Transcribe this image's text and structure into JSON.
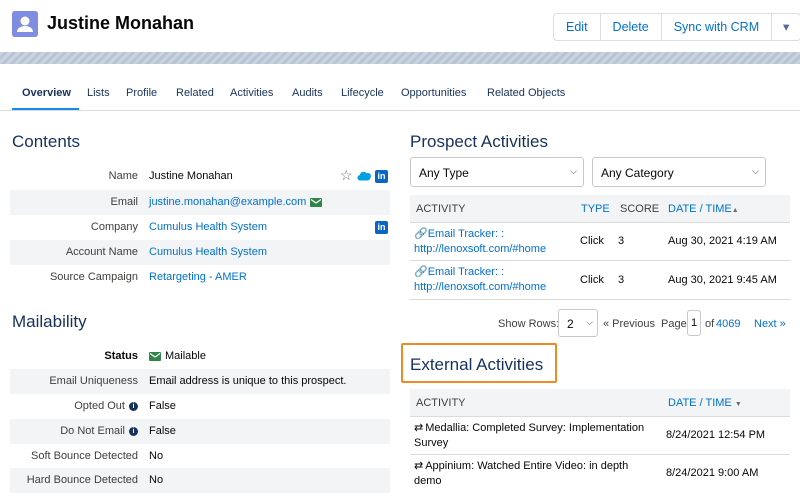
{
  "record": {
    "name": "Justine Monahan"
  },
  "actions": {
    "edit": "Edit",
    "delete": "Delete",
    "sync": "Sync with CRM",
    "more": "▾"
  },
  "tabs": [
    "Overview",
    "Lists",
    "Profile",
    "Related",
    "Activities",
    "Audits",
    "Lifecycle",
    "Opportunities",
    "Related Objects"
  ],
  "contents": {
    "title": "Contents",
    "rows": [
      {
        "label": "Name",
        "value": "Justine Monahan"
      },
      {
        "label": "Email",
        "value": "justine.monahan@example.com"
      },
      {
        "label": "Company",
        "value": "Cumulus Health System"
      },
      {
        "label": "Account Name",
        "value": "Cumulus Health System"
      },
      {
        "label": "Source Campaign",
        "value": "Retargeting - AMER"
      }
    ]
  },
  "mailability": {
    "title": "Mailability",
    "rows": [
      {
        "label": "Status",
        "value": "Mailable"
      },
      {
        "label": "Email Uniqueness",
        "value": "Email address is unique to this prospect."
      },
      {
        "label": "Opted Out",
        "value": "False"
      },
      {
        "label": "Do Not Email",
        "value": "False"
      },
      {
        "label": "Soft Bounce Detected",
        "value": "No"
      },
      {
        "label": "Hard Bounce Detected",
        "value": "No"
      }
    ]
  },
  "prospect_activities": {
    "title": "Prospect Activities",
    "type_filter": "Any Type",
    "category_filter": "Any Category",
    "headers": {
      "activity": "ACTIVITY",
      "type": "TYPE",
      "score": "SCORE",
      "date": "DATE / TIME"
    },
    "rows": [
      {
        "activity_line1": "Email Tracker: :",
        "activity_line2": "http://lenoxsoft.com/#home",
        "type": "Click",
        "score": "3",
        "date": "Aug 30, 2021 4:19 AM"
      },
      {
        "activity_line1": "Email Tracker: :",
        "activity_line2": "http://lenoxsoft.com/#home",
        "type": "Click",
        "score": "3",
        "date": "Aug 30, 2021 9:45 AM"
      }
    ],
    "pager": {
      "show_rows_label": "Show Rows:",
      "rows_value": "2",
      "previous": "« Previous",
      "page_label": "Page",
      "page_value": "1",
      "of_label": "of",
      "total_pages": "4069",
      "next": "Next »"
    }
  },
  "external_activities": {
    "title": "External Activities",
    "headers": {
      "activity": "ACTIVITY",
      "date": "DATE / TIME"
    },
    "rows": [
      {
        "activity_line1": "Medallia: Completed Survey: Implementation",
        "activity_line2": "Survey",
        "date": "8/24/2021 12:54 PM"
      },
      {
        "activity_line1": "Appinium: Watched Entire Video: in depth",
        "activity_line2": "demo",
        "date": "8/24/2021 9:00 AM"
      }
    ]
  },
  "colors": {
    "accent": "#0070d2",
    "highlight": "#f08a24",
    "tab_underline": "#1589ee"
  }
}
